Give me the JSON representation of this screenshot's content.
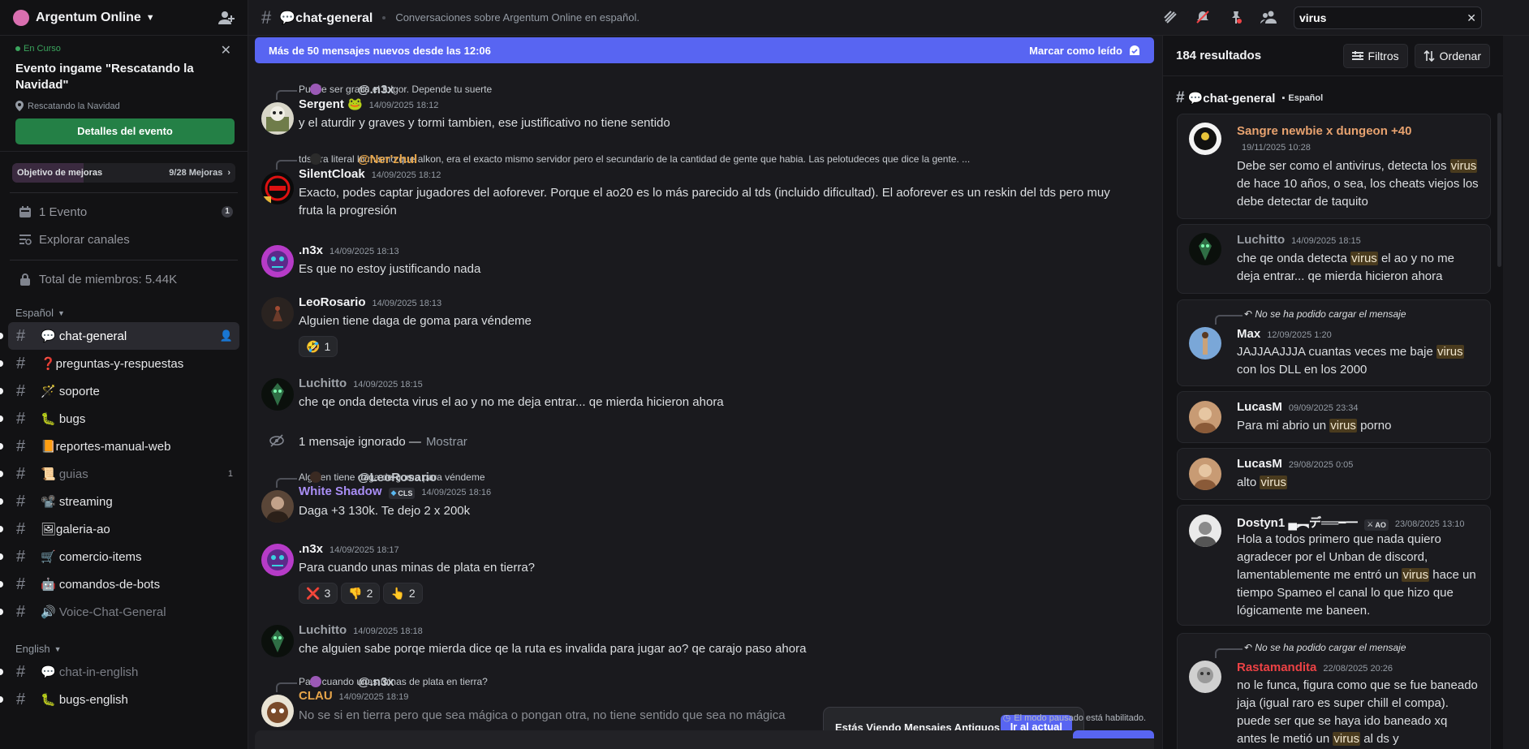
{
  "server": {
    "name": "Argentum Online"
  },
  "event": {
    "status": "En Curso",
    "title": "Evento ingame \"Rescatando la Navidad\"",
    "location": "Rescatando la Navidad",
    "button": "Detalles del evento"
  },
  "goal": {
    "label": "Objetivo de mejoras",
    "count": "9/28 Mejoras",
    "progress_fraction": 0.32
  },
  "sidebar_rows": [
    {
      "label": "1 Evento",
      "badge": "1"
    },
    {
      "label": "Explorar canales"
    },
    {
      "label": "Total de miembros: 5.44K"
    }
  ],
  "categories": {
    "es": "Español",
    "en": "English"
  },
  "channels": [
    {
      "name": "💬 chat-general",
      "state": "active"
    },
    {
      "name": "❓preguntas-y-respuestas"
    },
    {
      "name": "🪄 soporte"
    },
    {
      "name": "🐛 bugs"
    },
    {
      "name": "📙reportes-manual-web"
    },
    {
      "name": "📜 guias",
      "state": "muted",
      "badge": "1"
    },
    {
      "name": "📽️ streaming"
    },
    {
      "name": "🖼galeria-ao"
    },
    {
      "name": "🛒 comercio-items"
    },
    {
      "name": "🤖 comandos-de-bots"
    },
    {
      "name": "🔊 Voice-Chat-General",
      "state": "muted"
    }
  ],
  "channels_en": [
    {
      "name": "💬 chat-in-english",
      "state": "muted"
    },
    {
      "name": "🐛 bugs-english"
    }
  ],
  "topbar": {
    "channel": "💬chat-general",
    "topic": "Conversaciones sobre Argentum Online en español.",
    "search_value": "virus"
  },
  "new_messages": {
    "text": "Más de 50 mensajes nuevos desde las 12:06",
    "mark_read": "Marcar como leído"
  },
  "messages": [
    {
      "reply_name": "@.n3x",
      "reply_text": "Puede ser gratis el fulgor. Depende tu suerte",
      "author": "Sergent 🐸",
      "time": "14/09/2025 18:12",
      "text": "y el aturdir y graves y tormi tambien, ese justificativo no tiene sentido"
    },
    {
      "reply_name": "@Ner'zhul",
      "reply_text": "tds era literal lo mismo que alkon, era el exacto mismo servidor pero el secundario de la cantidad de gente que habia. Las pelotudeces que dice la gente. ...",
      "author": "SilentCloak",
      "time": "14/09/2025 18:12",
      "text": "Exacto, podes captar jugadores del aoforever. Porque el ao20 es lo más parecido al tds (incluido dificultad). El aoforever es un reskin del tds pero muy fruta la progresión"
    },
    {
      "author": ".n3x",
      "time": "14/09/2025 18:13",
      "text": "Es que no estoy justificando nada"
    },
    {
      "author": "LeoRosario",
      "time": "14/09/2025 18:13",
      "text": "Alguien tiene daga de goma para véndeme",
      "reactions": [
        {
          "emoji": "🤣",
          "count": "1"
        }
      ]
    },
    {
      "author": "Luchitto",
      "time": "14/09/2025 18:15",
      "text": "che qe onda detecta virus el ao y no me deja entrar... qe mierda hicieron ahora"
    },
    {
      "ignored": "1 mensaje ignorado —",
      "show": "Mostrar"
    },
    {
      "reply_name": "@LeoRosario",
      "reply_text": "Alguien tiene daga de goma para véndeme",
      "author": "White Shadow",
      "tag": "CLS",
      "time": "14/09/2025 18:16",
      "text": "Daga +3 130k. Te dejo 2 x 200k"
    },
    {
      "author": ".n3x",
      "time": "14/09/2025 18:17",
      "text": "Para cuando unas minas de plata en tierra?",
      "reactions": [
        {
          "emoji": "❌",
          "count": "3"
        },
        {
          "emoji": "👎",
          "count": "2"
        },
        {
          "emoji": "👆",
          "count": "2"
        }
      ]
    },
    {
      "author": "Luchitto",
      "time": "14/09/2025 18:18",
      "text": "che alguien sabe porqe mierda dice qe la ruta es invalida para jugar ao? qe carajo paso ahora"
    },
    {
      "reply_name": "@.n3x",
      "reply_text": "Para cuando unas minas de plata en tierra?",
      "author": "CLAU",
      "time": "14/09/2025 18:19",
      "text": "No se si en tierra pero que sea mágica o pongan otra, no tiene sentido que sea no mágica"
    }
  ],
  "old_messages": {
    "text": "Estás Viendo Mensajes Antiguos",
    "button": "Ir al actual"
  },
  "pause_text": "El modo pausado está habilitado.",
  "results": {
    "count": "184 resultados",
    "filters": "Filtros",
    "sort": "Ordenar",
    "channel": "💬chat-general",
    "category": "Español",
    "items": [
      {
        "author": "Sangre newbie x dungeon +40",
        "time": "19/11/2025 10:28",
        "pre": "Debe ser como el antivirus, detecta los ",
        "hl": "virus",
        "post": " de hace 10 años, o sea, los cheats viejos los debe detectar de taquito"
      },
      {
        "author": "Luchitto",
        "time": "14/09/2025 18:15",
        "pre": "che qe onda detecta ",
        "hl": "virus",
        "post": " el ao y no me deja entrar... qe mierda hicieron ahora"
      },
      {
        "reply": "No se ha podido cargar el mensaje",
        "author": "Max",
        "time": "12/09/2025 1:20",
        "pre": "JAJJAAJJJA cuantas veces me baje ",
        "hl": "virus",
        "post": " con los DLL en los 2000"
      },
      {
        "author": "LucasM",
        "time": "09/09/2025 23:34",
        "pre": "Para mi abrio un ",
        "hl": "virus",
        "post": " porno"
      },
      {
        "author": "LucasM",
        "time": "29/08/2025 0:05",
        "pre": "alto ",
        "hl": "virus",
        "post": ""
      },
      {
        "author": "Dostyn1 ▄︻デ══━一",
        "tag": "AO",
        "time": "23/08/2025 13:10",
        "pre": "Hola a todos primero que nada quiero agradecer por el Unban de discord, lamentablemente me entró un ",
        "hl": "virus",
        "post": " hace un tiempo Spameo el canal lo que hizo que lógicamente me baneen."
      },
      {
        "reply": "No se ha podido cargar el mensaje",
        "author": "Rastamandita",
        "time": "22/08/2025 20:26",
        "pre": "no le funca, figura como que se fue baneado jaja (igual raro es super chill el compa). puede ser que se haya ido baneado xq antes le metió un ",
        "hl": "virus",
        "post": " al ds y"
      }
    ]
  },
  "colors": {
    "accent": "#5865f2",
    "green": "#248046",
    "highlight": "#4a3b1e"
  }
}
